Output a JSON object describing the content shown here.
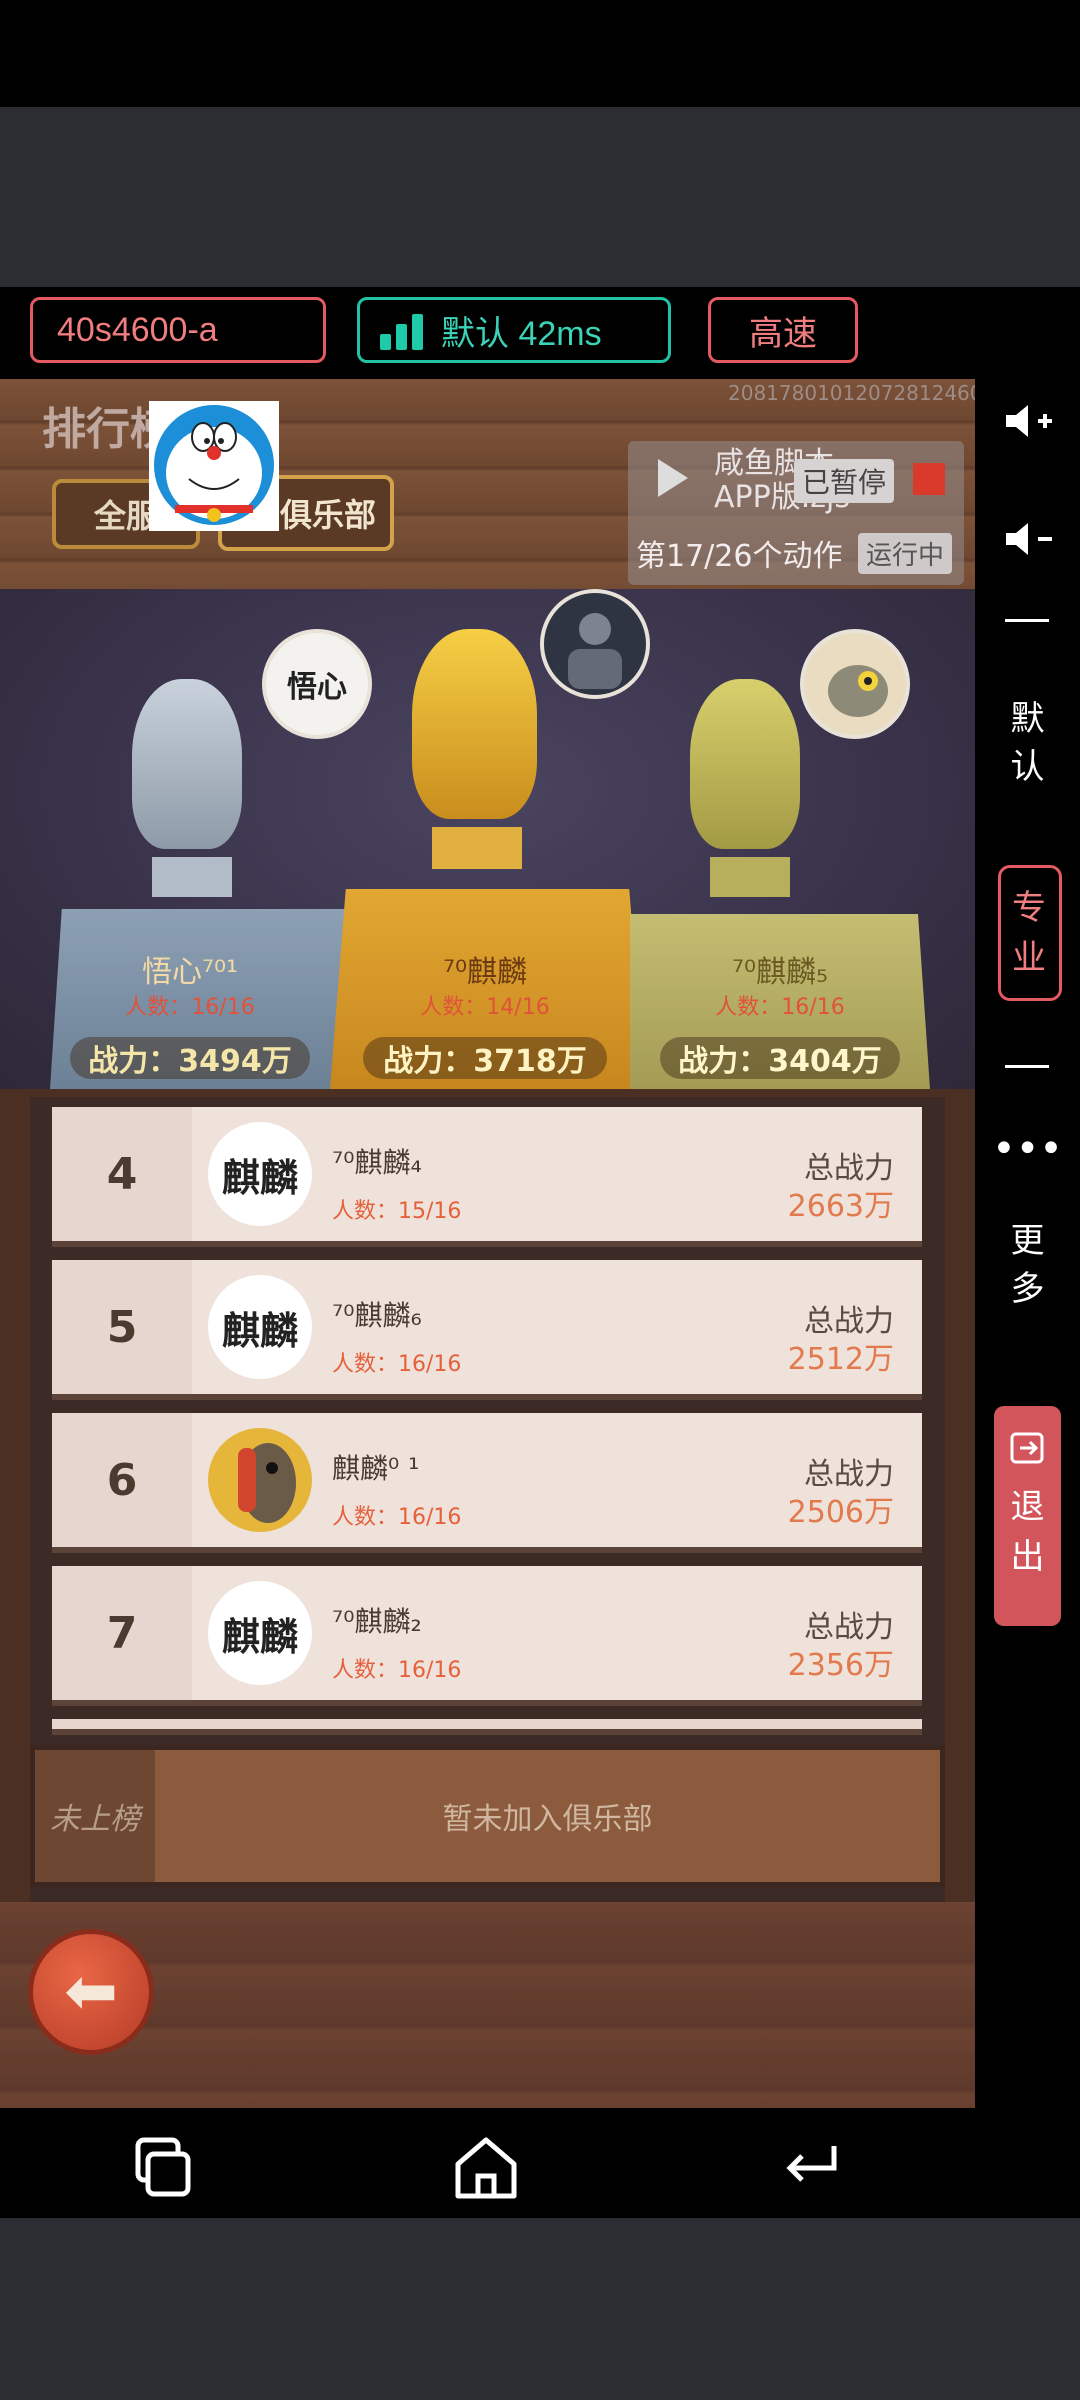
{
  "toolbar": {
    "device_label": "40s4600-a",
    "network_label": "默认 42ms",
    "speed_label": "高速"
  },
  "right_panel": {
    "default_label": "默认",
    "pro_label": "专业",
    "more_label": "更多",
    "exit_label": "退出"
  },
  "game": {
    "title": "排行榜",
    "tab_all": "全服",
    "tab_club": "俱乐部",
    "version": "20817801012072812460",
    "overlay": {
      "script_name": "咸鱼脚本APP版.zjs",
      "paused_label": "已暂停",
      "progress": "第17/26个动作",
      "running_label": "运行中"
    },
    "podium": [
      {
        "rank": "2",
        "name": "悟心⁷⁰¹",
        "count": "人数：16/16",
        "power": "战力：3494万",
        "avatar_text": "悟心"
      },
      {
        "rank": "1",
        "name": "⁷⁰麒麟",
        "count": "人数：14/16",
        "power": "战力：3718万",
        "avatar_text": ""
      },
      {
        "rank": "3",
        "name": "⁷⁰麒麟₅",
        "count": "人数：16/16",
        "power": "战力：3404万",
        "avatar_text": ""
      }
    ],
    "list": [
      {
        "rank": "4",
        "name": "⁷⁰麒麟₄",
        "count": "人数：15/16",
        "label": "总战力",
        "power": "2663万",
        "avatar_text": "麒麟"
      },
      {
        "rank": "5",
        "name": "⁷⁰麒麟₆",
        "count": "人数：16/16",
        "label": "总战力",
        "power": "2512万",
        "avatar_text": "麒麟"
      },
      {
        "rank": "6",
        "name": "麒麟⁰ ¹",
        "count": "人数：16/16",
        "label": "总战力",
        "power": "2506万",
        "avatar_text": ""
      },
      {
        "rank": "7",
        "name": "⁷⁰麒麟₂",
        "count": "人数：16/16",
        "label": "总战力",
        "power": "2356万",
        "avatar_text": "麒麟"
      }
    ],
    "unranked_label": "未上榜",
    "unranked_text": "暂未加入俱乐部"
  },
  "icons": {
    "volume_up": "volume-up-icon",
    "volume_down": "volume-down-icon",
    "more": "more-dots-icon",
    "exit": "exit-icon",
    "nav_recent": "recent-apps-icon",
    "nav_home": "home-icon",
    "nav_back": "back-icon"
  },
  "colors": {
    "accent_red": "#e35a60",
    "accent_teal": "#21c2a6",
    "gold": "#e6b032",
    "silver": "#a9b3bf"
  }
}
